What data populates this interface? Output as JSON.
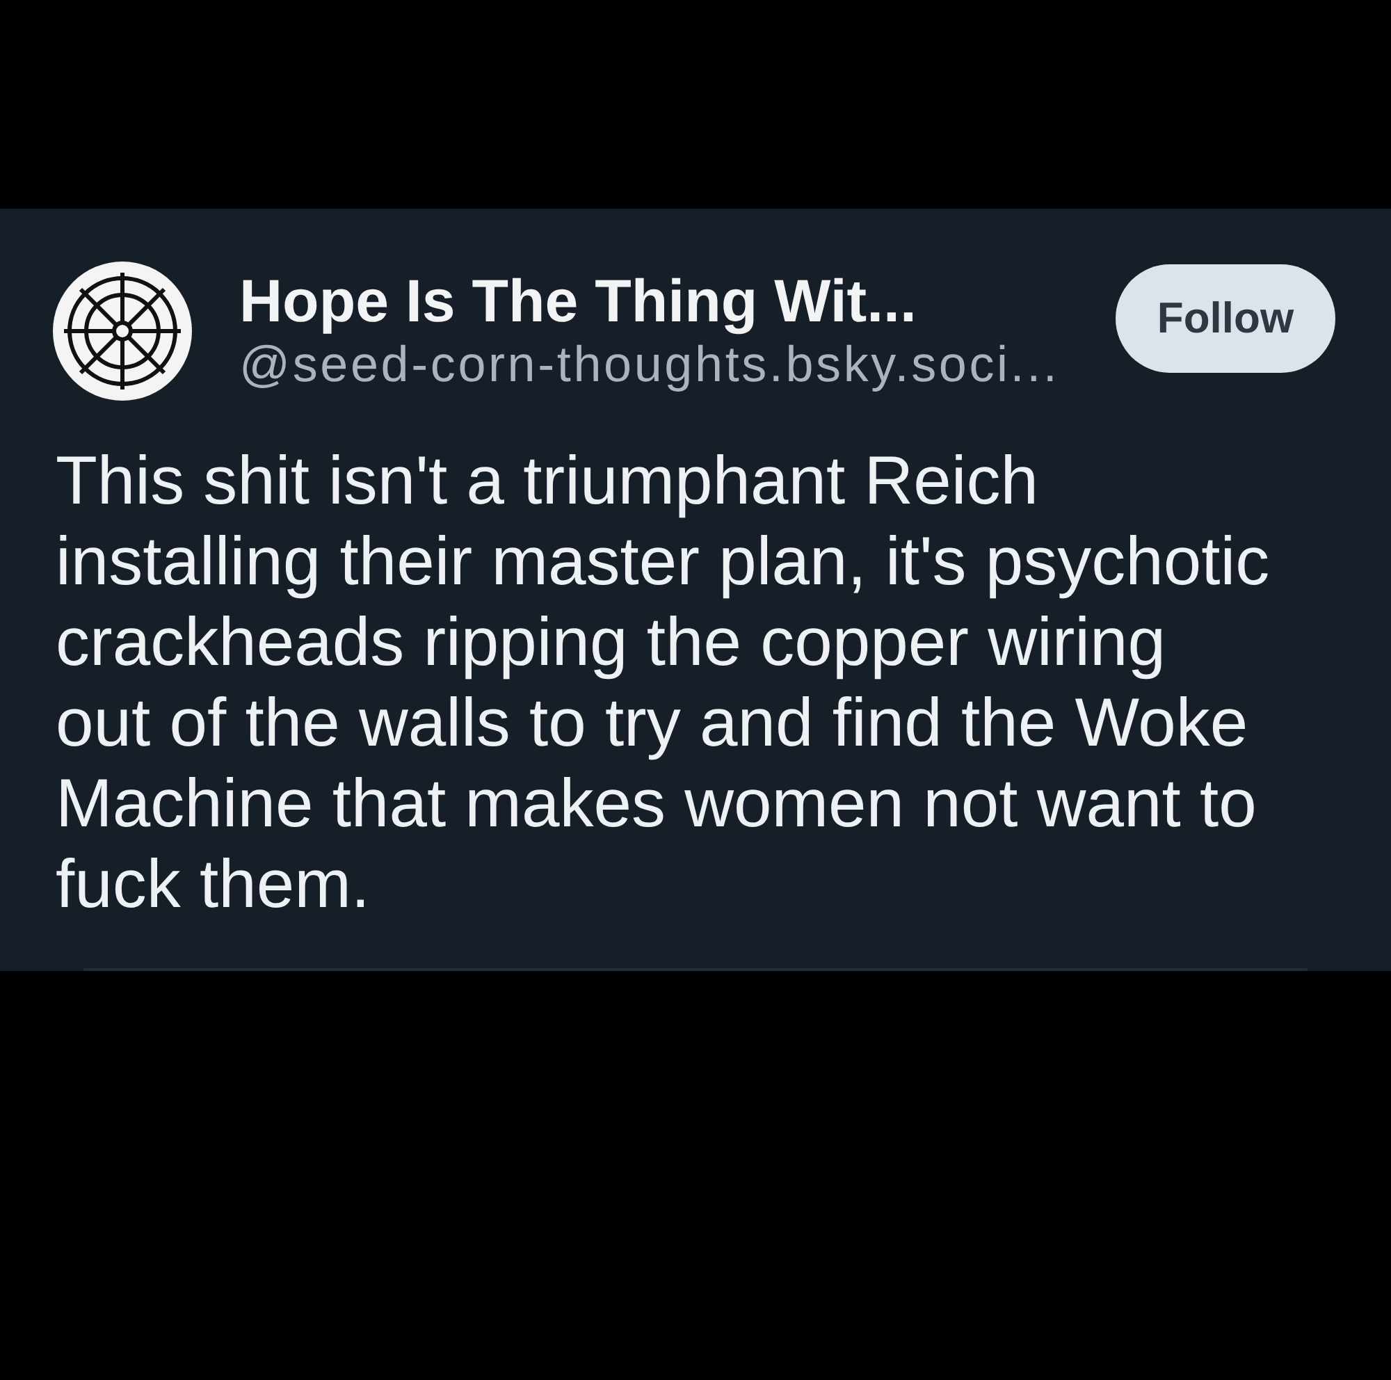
{
  "post": {
    "author": {
      "display_name": "Hope Is The Thing Wit...",
      "handle": "@seed-corn-thoughts.bsky.soci..."
    },
    "follow_button": {
      "label": "Follow"
    },
    "text": "This shit isn't a triumphant Reich installing their master plan, it's psychotic crackheads ripping the copper wiring out of the walls to try and find the Woke Machine that makes women not want to fuck them."
  }
}
